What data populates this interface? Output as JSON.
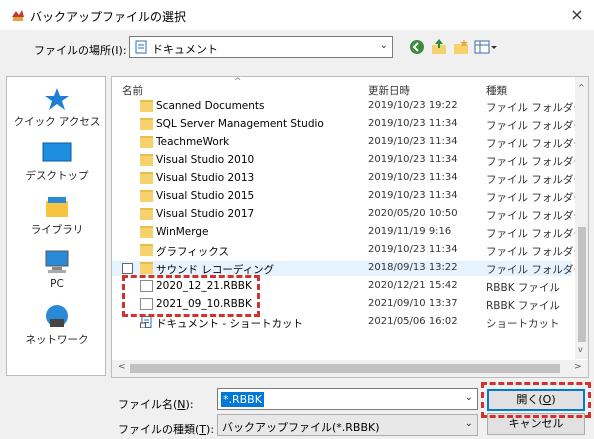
{
  "window": {
    "title": "バックアップファイルの選択",
    "close_glyph": "×"
  },
  "location": {
    "label": "ファイルの場所(I):",
    "value": "ドキュメント"
  },
  "places": [
    {
      "label": "クイック アクセス",
      "icon": "star-icon"
    },
    {
      "label": "デスクトップ",
      "icon": "desktop-icon"
    },
    {
      "label": "ライブラリ",
      "icon": "library-icon"
    },
    {
      "label": "PC",
      "icon": "pc-icon"
    },
    {
      "label": "ネットワーク",
      "icon": "network-icon"
    }
  ],
  "columns": {
    "name": "名前",
    "date": "更新日時",
    "type": "種類"
  },
  "files": [
    {
      "name": "Scanned Documents",
      "date": "2019/10/23 19:22",
      "type": "ファイル フォルダー",
      "kind": "folder"
    },
    {
      "name": "SQL Server Management Studio",
      "date": "2019/10/23 11:34",
      "type": "ファイル フォルダー",
      "kind": "folder"
    },
    {
      "name": "TeachmeWork",
      "date": "2019/10/23 11:34",
      "type": "ファイル フォルダー",
      "kind": "folder"
    },
    {
      "name": "Visual Studio 2010",
      "date": "2019/10/23 11:34",
      "type": "ファイル フォルダー",
      "kind": "folder"
    },
    {
      "name": "Visual Studio 2013",
      "date": "2019/10/23 11:34",
      "type": "ファイル フォルダー",
      "kind": "folder"
    },
    {
      "name": "Visual Studio 2015",
      "date": "2019/10/23 11:34",
      "type": "ファイル フォルダー",
      "kind": "folder"
    },
    {
      "name": "Visual Studio 2017",
      "date": "2020/05/20 10:50",
      "type": "ファイル フォルダー",
      "kind": "folder"
    },
    {
      "name": "WinMerge",
      "date": "2019/11/19 9:16",
      "type": "ファイル フォルダー",
      "kind": "folder"
    },
    {
      "name": "グラフィックス",
      "date": "2019/10/23 11:34",
      "type": "ファイル フォルダー",
      "kind": "folder"
    },
    {
      "name": "サウンド レコーディング",
      "date": "2018/09/13 13:22",
      "type": "ファイル フォルダー",
      "kind": "folder"
    },
    {
      "name": "2020_12_21.RBBK",
      "date": "2020/12/21 15:42",
      "type": "RBBK ファイル",
      "kind": "file"
    },
    {
      "name": "2021_09_10.RBBK",
      "date": "2021/09/10 13:37",
      "type": "RBBK ファイル",
      "kind": "file"
    },
    {
      "name": "ドキュメント - ショートカット",
      "date": "2021/05/06 16:02",
      "type": "ショートカット",
      "kind": "shortcut"
    }
  ],
  "filename": {
    "label_pre": "ファイル名(",
    "label_key": "N",
    "label_post": "):",
    "value": "*.RBBK"
  },
  "filetype": {
    "label_pre": "ファイルの種類(",
    "label_key": "T",
    "label_post": "):",
    "value": "バックアップファイル(*.RBBK)"
  },
  "buttons": {
    "open_pre": "開く(",
    "open_key": "O",
    "open_post": ")",
    "cancel": "キャンセル"
  }
}
